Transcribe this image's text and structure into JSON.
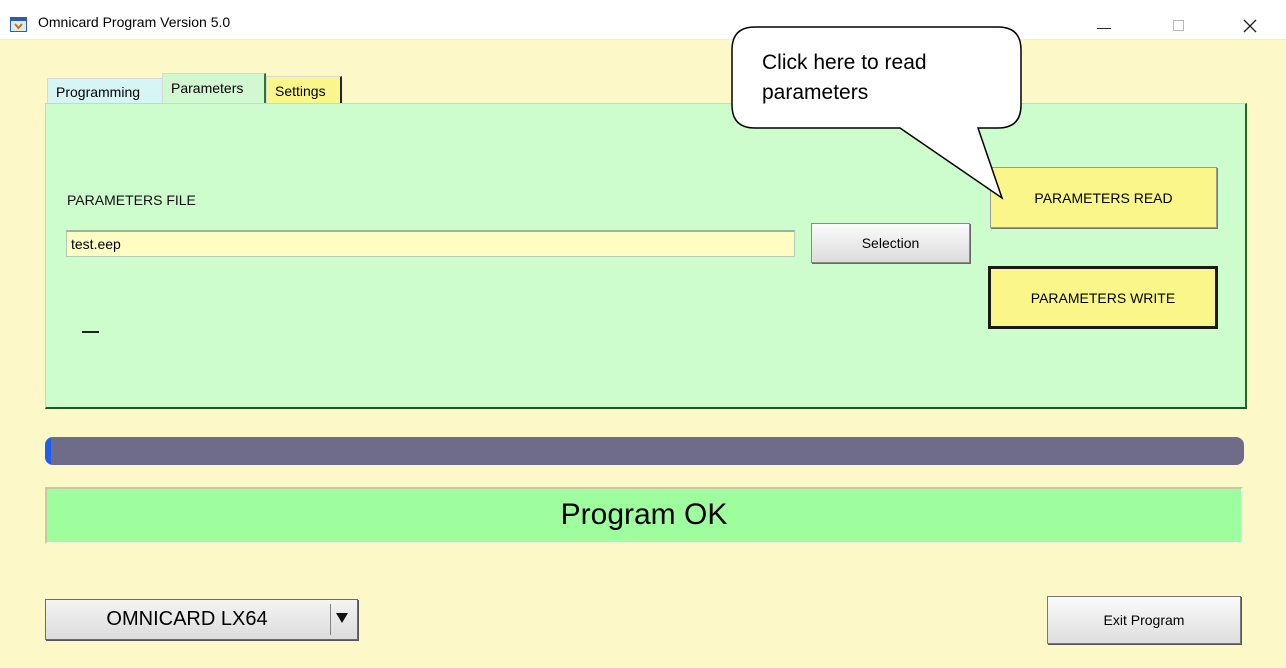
{
  "window": {
    "title": "Omnicard Program Version 5.0",
    "minimize_glyph": "",
    "maximize_glyph": "",
    "close_glyph": "✕"
  },
  "tabs": [
    {
      "label": "Programming",
      "color": "#d6f6f6"
    },
    {
      "label": "Parameters",
      "color": "#d2f8d2",
      "selected": true
    },
    {
      "label": "Settings",
      "color": "#fbf68a"
    }
  ],
  "parameters": {
    "file_label": "PARAMETERS FILE",
    "file_value": "test.eep",
    "selection_button": "Selection",
    "read_button": "PARAMETERS READ",
    "write_button": "PARAMETERS WRITE",
    "dash": "—"
  },
  "callout": {
    "line1": "Click here to read",
    "line2": "parameters"
  },
  "progress": {
    "fraction": 0.004,
    "track_color": "#6f6c8a",
    "fill_color": "#1d5ff0"
  },
  "status": {
    "text": "Program OK",
    "color": "#9efe9e"
  },
  "device": {
    "selected": "OMNICARD LX64"
  },
  "exit_button": "Exit Program",
  "colors": {
    "background": "#fdf8c8",
    "panel": "#cdfccd",
    "button_yellow": "#fbf68a"
  }
}
